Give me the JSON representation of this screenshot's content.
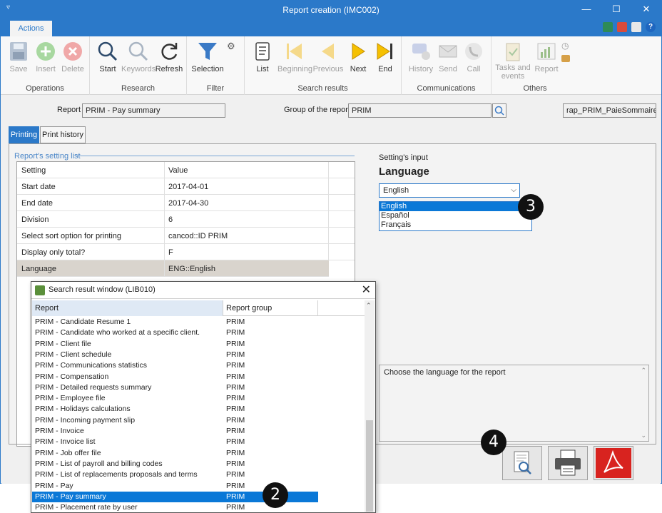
{
  "window": {
    "title": "Report creation (IMC002)",
    "controls": [
      "—",
      "☐",
      "✕"
    ],
    "ribbon_tab": "Actions"
  },
  "ribbon": {
    "groups": [
      {
        "label": "Operations",
        "buttons": [
          {
            "label": "Save",
            "icon": "save-icon",
            "enabled": false
          },
          {
            "label": "Insert",
            "icon": "plus-circle-icon",
            "enabled": false
          },
          {
            "label": "Delete",
            "icon": "x-circle-icon",
            "enabled": false
          }
        ]
      },
      {
        "label": "Research",
        "buttons": [
          {
            "label": "Start",
            "icon": "magnifier-icon",
            "enabled": true
          },
          {
            "label": "Keywords",
            "icon": "keyword-magnifier-icon",
            "enabled": false
          },
          {
            "label": "Refresh",
            "icon": "refresh-icon",
            "enabled": true
          }
        ]
      },
      {
        "label": "Filter",
        "buttons": [
          {
            "label": "Selection",
            "icon": "funnel-icon",
            "enabled": true
          }
        ]
      },
      {
        "label": "Search results",
        "buttons": [
          {
            "label": "List",
            "icon": "scroll-list-icon",
            "enabled": true
          },
          {
            "label": "Beginning",
            "icon": "first-icon",
            "enabled": false
          },
          {
            "label": "Previous",
            "icon": "previous-icon",
            "enabled": false
          },
          {
            "label": "Next",
            "icon": "next-icon",
            "enabled": true
          },
          {
            "label": "End",
            "icon": "last-icon",
            "enabled": true
          }
        ]
      },
      {
        "label": "Communications",
        "buttons": [
          {
            "label": "History",
            "icon": "history-icon",
            "enabled": false
          },
          {
            "label": "Send",
            "icon": "envelope-icon",
            "enabled": false
          },
          {
            "label": "Call",
            "icon": "phone-icon",
            "enabled": false
          }
        ]
      },
      {
        "label": "Others",
        "buttons": [
          {
            "label": "Tasks and events",
            "icon": "clipboard-check-icon",
            "enabled": false
          },
          {
            "label": "Report",
            "icon": "bar-chart-icon",
            "enabled": false
          }
        ]
      }
    ]
  },
  "form": {
    "report_label": "Report",
    "report_value": "PRIM - Pay summary",
    "group_label": "Group of the report",
    "group_value": "PRIM",
    "file_value": "rap_PRIM_PaieSommaire.re"
  },
  "tabs": [
    {
      "label": "Printing",
      "active": true
    },
    {
      "label": "Print history",
      "active": false
    }
  ],
  "settings": {
    "legend": "Report's setting list",
    "columns": [
      "Setting",
      "Value"
    ],
    "rows": [
      {
        "setting": "Start date",
        "value": "2017-04-01"
      },
      {
        "setting": "End date",
        "value": "2017-04-30"
      },
      {
        "setting": "Division",
        "value": "6"
      },
      {
        "setting": "Select sort option for printing",
        "value": "cancod::ID PRIM"
      },
      {
        "setting": "Display only total?",
        "value": "F"
      },
      {
        "setting": "Language",
        "value": "ENG::English"
      }
    ]
  },
  "input": {
    "caption": "Setting's input",
    "heading": "Language",
    "selected": "English",
    "options": [
      "English",
      "Español",
      "Français"
    ],
    "description": "Choose the language for the report"
  },
  "callouts": [
    "2",
    "3",
    "4"
  ],
  "popup": {
    "title": "Search result window (LIB010)",
    "columns": [
      "Report",
      "Report group"
    ],
    "rows": [
      {
        "report": "PRIM - Candidate Resume 1",
        "group": "PRIM"
      },
      {
        "report": "PRIM - Candidate who worked at a specific client.",
        "group": "PRIM"
      },
      {
        "report": "PRIM - Client file",
        "group": "PRIM"
      },
      {
        "report": "PRIM - Client schedule",
        "group": "PRIM"
      },
      {
        "report": "PRIM - Communications statistics",
        "group": "PRIM"
      },
      {
        "report": "PRIM - Compensation",
        "group": "PRIM"
      },
      {
        "report": "PRIM - Detailed requests summary",
        "group": "PRIM"
      },
      {
        "report": "PRIM - Employee file",
        "group": "PRIM"
      },
      {
        "report": "PRIM - Holidays calculations",
        "group": "PRIM"
      },
      {
        "report": "PRIM - Incoming payment slip",
        "group": "PRIM"
      },
      {
        "report": "PRIM - Invoice",
        "group": "PRIM"
      },
      {
        "report": "PRIM - Invoice list",
        "group": "PRIM"
      },
      {
        "report": "PRIM - Job offer file",
        "group": "PRIM"
      },
      {
        "report": "PRIM - List of payroll and billing codes",
        "group": "PRIM"
      },
      {
        "report": "PRIM - List of replacements proposals and terms",
        "group": "PRIM"
      },
      {
        "report": "PRIM - Pay",
        "group": "PRIM"
      },
      {
        "report": "PRIM - Pay summary",
        "group": "PRIM",
        "selected": true
      },
      {
        "report": "PRIM - Placement rate by user",
        "group": "PRIM"
      }
    ]
  },
  "colors": {
    "accent": "#2b79c9",
    "selection": "#0a78d7"
  }
}
